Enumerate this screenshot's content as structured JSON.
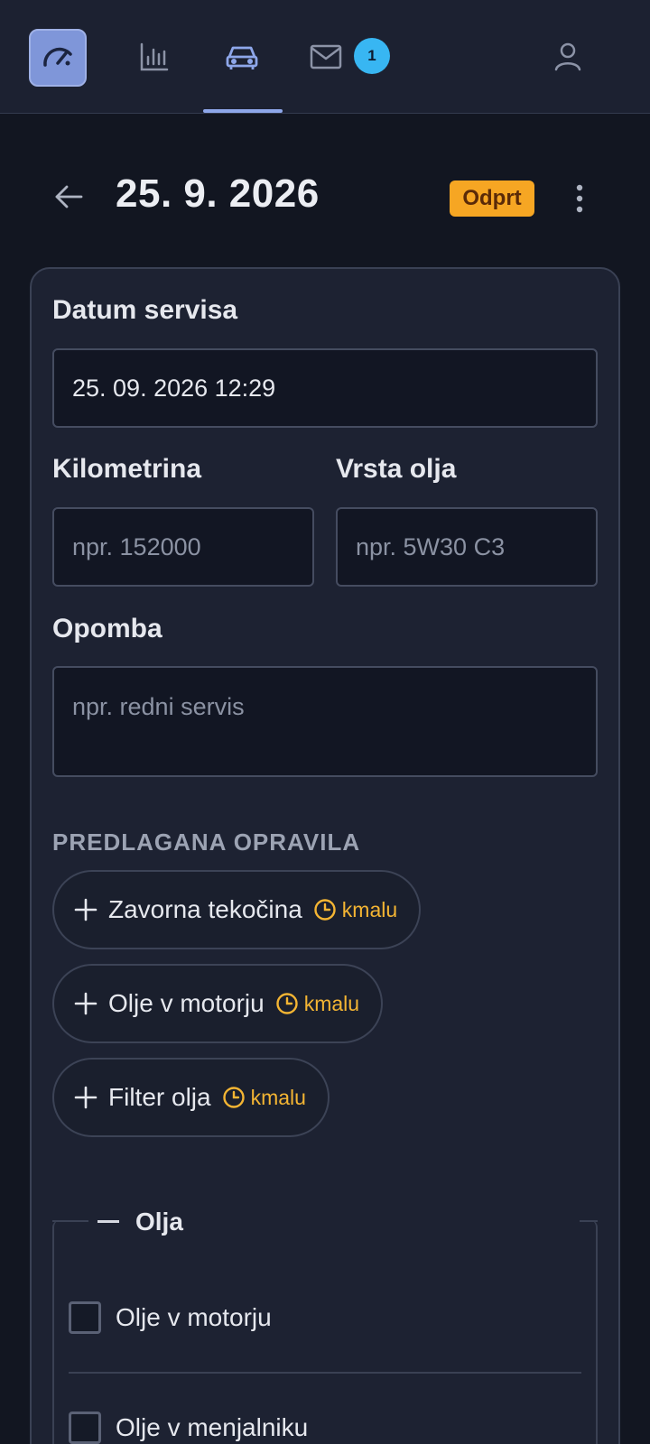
{
  "nav": {
    "logo_icon": "speedometer-icon",
    "items": [
      {
        "icon": "bar-chart-icon"
      },
      {
        "icon": "car-icon",
        "active": true
      },
      {
        "icon": "mail-icon",
        "badge": "1"
      }
    ],
    "profile_icon": "user-icon"
  },
  "header": {
    "title": "25. 9. 2026",
    "status": "Odprt"
  },
  "form": {
    "date_label": "Datum servisa",
    "date_value": "25. 09. 2026 12:29",
    "km_label": "Kilometrina",
    "km_placeholder": "npr. 152000",
    "oil_label": "Vrsta olja",
    "oil_placeholder": "npr. 5W30 C3",
    "note_label": "Opomba",
    "note_placeholder": "npr. redni servis"
  },
  "suggested": {
    "caption": "PREDLAGANA OPRAVILA",
    "items": [
      {
        "label": "Zavorna tekočina",
        "soon": "kmalu"
      },
      {
        "label": "Olje v motorju",
        "soon": "kmalu"
      },
      {
        "label": "Filter olja",
        "soon": "kmalu"
      }
    ]
  },
  "group": {
    "title": "Olja",
    "items": [
      {
        "label": "Olje v motorju",
        "checked": false
      },
      {
        "label": "Olje v menjalniku",
        "checked": false
      }
    ]
  },
  "colors": {
    "accent": "#8ea7ea",
    "status": "#f6a623",
    "soon": "#f4b533",
    "badge": "#38b6f2"
  }
}
